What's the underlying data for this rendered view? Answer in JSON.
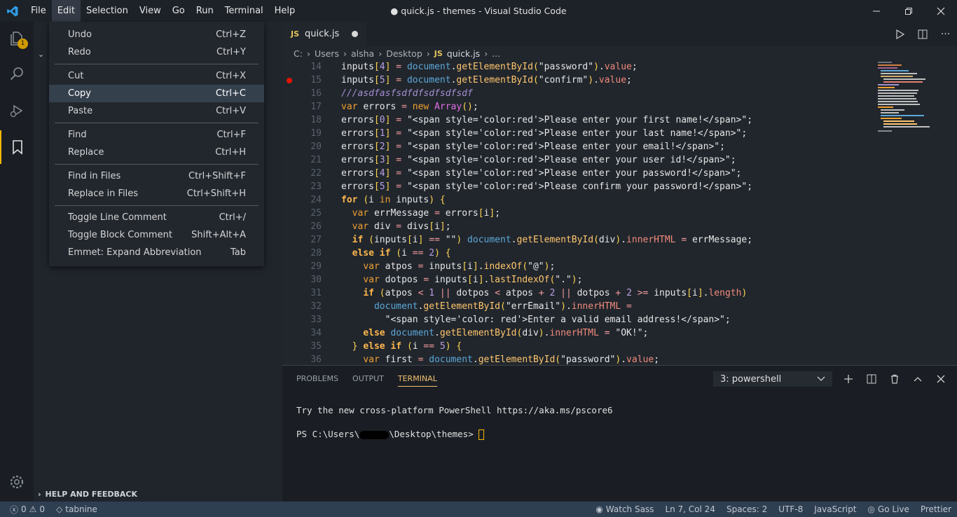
{
  "window": {
    "title": "● quick.js - themes - Visual Studio Code"
  },
  "menubar": [
    "File",
    "Edit",
    "Selection",
    "View",
    "Go",
    "Run",
    "Terminal",
    "Help"
  ],
  "activity": {
    "badge": "1"
  },
  "edit_menu": {
    "groups": [
      [
        {
          "label": "Undo",
          "shortcut": "Ctrl+Z"
        },
        {
          "label": "Redo",
          "shortcut": "Ctrl+Y"
        }
      ],
      [
        {
          "label": "Cut",
          "shortcut": "Ctrl+X"
        },
        {
          "label": "Copy",
          "shortcut": "Ctrl+C"
        },
        {
          "label": "Paste",
          "shortcut": "Ctrl+V"
        }
      ],
      [
        {
          "label": "Find",
          "shortcut": "Ctrl+F"
        },
        {
          "label": "Replace",
          "shortcut": "Ctrl+H"
        }
      ],
      [
        {
          "label": "Find in Files",
          "shortcut": "Ctrl+Shift+F"
        },
        {
          "label": "Replace in Files",
          "shortcut": "Ctrl+Shift+H"
        }
      ],
      [
        {
          "label": "Toggle Line Comment",
          "shortcut": "Ctrl+/"
        },
        {
          "label": "Toggle Block Comment",
          "shortcut": "Shift+Alt+A"
        },
        {
          "label": "Emmet: Expand Abbreviation",
          "shortcut": "Tab"
        }
      ]
    ],
    "highlighted": "Copy"
  },
  "sidebar": {
    "help_feedback": "HELP AND FEEDBACK"
  },
  "tab": {
    "icon": "JS",
    "name": "quick.js"
  },
  "breadcrumb": {
    "parts": [
      "C:",
      "Users",
      "alsha",
      "Desktop"
    ],
    "file_icon": "JS",
    "file": "quick.js",
    "more": "..."
  },
  "editor": {
    "breakpoint_line": "15",
    "lines": [
      {
        "n": "14",
        "html": "<span class='id'>inputs</span><span class='br'>[</span><span class='num'>4</span><span class='br'>]</span> <span class='op'>=</span> <span class='dom'>document</span>.<span class='mt'>getElementById</span><span class='br'>(</span><span class='st'>\"password\"</span><span class='br'>)</span>.<span class='prop'>value</span>;"
      },
      {
        "n": "15",
        "html": "<span class='id'>inputs</span><span class='br'>[</span><span class='num'>5</span><span class='br'>]</span> <span class='op'>=</span> <span class='dom'>document</span>.<span class='mt'>getElementById</span><span class='br'>(</span><span class='st'>\"confirm\"</span><span class='br'>)</span>.<span class='prop'>value</span>;"
      },
      {
        "n": "16",
        "html": "<span class='cm'>///asdfasfsdfdfsdfsdfsdf</span>"
      },
      {
        "n": "17",
        "html": "<span class='kw'>var</span> <span class='id'>errors</span> <span class='op'>=</span> <span class='kw'>new</span> <span class='cls'>Array</span><span class='br'>()</span>;"
      },
      {
        "n": "18",
        "html": "<span class='id'>errors</span><span class='br'>[</span><span class='num'>0</span><span class='br'>]</span> <span class='op'>=</span> <span class='st'>\"&lt;span style='color:red'&gt;Please enter your first name!&lt;/span&gt;\"</span>;"
      },
      {
        "n": "19",
        "html": "<span class='id'>errors</span><span class='br'>[</span><span class='num'>1</span><span class='br'>]</span> <span class='op'>=</span> <span class='st'>\"&lt;span style='color:red'&gt;Please enter your last name!&lt;/span&gt;\"</span>;"
      },
      {
        "n": "20",
        "html": "<span class='id'>errors</span><span class='br'>[</span><span class='num'>2</span><span class='br'>]</span> <span class='op'>=</span> <span class='st'>\"&lt;span style='color:red'&gt;Please enter your email!&lt;/span&gt;\"</span>;"
      },
      {
        "n": "21",
        "html": "<span class='id'>errors</span><span class='br'>[</span><span class='num'>3</span><span class='br'>]</span> <span class='op'>=</span> <span class='st'>\"&lt;span style='color:red'&gt;Please enter your user id!&lt;/span&gt;\"</span>;"
      },
      {
        "n": "22",
        "html": "<span class='id'>errors</span><span class='br'>[</span><span class='num'>4</span><span class='br'>]</span> <span class='op'>=</span> <span class='st'>\"&lt;span style='color:red'&gt;Please enter your password!&lt;/span&gt;\"</span>;"
      },
      {
        "n": "23",
        "html": "<span class='id'>errors</span><span class='br'>[</span><span class='num'>5</span><span class='br'>]</span> <span class='op'>=</span> <span class='st'>\"&lt;span style='color:red'&gt;Please confirm your password!&lt;/span&gt;\"</span>;"
      },
      {
        "n": "24",
        "html": "<span class='kb'>for</span> <span class='br'>(</span><span class='id'>i</span> <span class='kw'>in</span> <span class='id'>inputs</span><span class='br'>)</span> <span class='br'>{</span>"
      },
      {
        "n": "25",
        "html": "  <span class='kw'>var</span> <span class='id'>errMessage</span> <span class='op'>=</span> <span class='id'>errors</span><span class='br'>[</span><span class='id'>i</span><span class='br'>]</span>;"
      },
      {
        "n": "26",
        "html": "  <span class='kw'>var</span> <span class='id'>div</span> <span class='op'>=</span> <span class='id'>divs</span><span class='br'>[</span><span class='id'>i</span><span class='br'>]</span>;"
      },
      {
        "n": "27",
        "html": "  <span class='kb'>if</span> <span class='br'>(</span><span class='id'>inputs</span><span class='br'>[</span><span class='id'>i</span><span class='br'>]</span> <span class='op'>==</span> <span class='st'>\"\"</span><span class='br'>)</span> <span class='dom'>document</span>.<span class='mt'>getElementById</span><span class='br'>(</span><span class='id'>div</span><span class='br'>)</span>.<span class='prop'>innerHTML</span> <span class='op'>=</span> <span class='id'>errMessage</span>;"
      },
      {
        "n": "28",
        "html": "  <span class='kb'>else if</span> <span class='br'>(</span><span class='id'>i</span> <span class='op'>==</span> <span class='num'>2</span><span class='br'>)</span> <span class='br'>{</span>"
      },
      {
        "n": "29",
        "html": "    <span class='kw'>var</span> <span class='id'>atpos</span> <span class='op'>=</span> <span class='id'>inputs</span><span class='br'>[</span><span class='id'>i</span><span class='br'>]</span>.<span class='mt'>indexOf</span><span class='br'>(</span><span class='st'>\"@\"</span><span class='br'>)</span>;"
      },
      {
        "n": "30",
        "html": "    <span class='kw'>var</span> <span class='id'>dotpos</span> <span class='op'>=</span> <span class='id'>inputs</span><span class='br'>[</span><span class='id'>i</span><span class='br'>]</span>.<span class='mt'>lastIndexOf</span><span class='br'>(</span><span class='st'>\".\"</span><span class='br'>)</span>;"
      },
      {
        "n": "31",
        "html": "    <span class='kb'>if</span> <span class='br'>(</span><span class='id'>atpos</span> <span class='op'>&lt;</span> <span class='num'>1</span> <span class='op'>||</span> <span class='id'>dotpos</span> <span class='op'>&lt;</span> <span class='id'>atpos</span> <span class='op'>+</span> <span class='num'>2</span> <span class='op'>||</span> <span class='id'>dotpos</span> <span class='op'>+</span> <span class='num'>2</span> <span class='op'>&gt;=</span> <span class='id'>inputs</span><span class='br'>[</span><span class='id'>i</span><span class='br'>]</span>.<span class='prop'>length</span><span class='br'>)</span>"
      },
      {
        "n": "32",
        "html": "      <span class='dom'>document</span>.<span class='mt'>getElementById</span><span class='br'>(</span><span class='st'>\"errEmail\"</span><span class='br'>)</span>.<span class='prop'>innerHTML</span> <span class='op'>=</span>"
      },
      {
        "n": "33",
        "html": "        <span class='st'>\"&lt;span style='color: red'&gt;Enter a valid email address!&lt;/span&gt;\"</span>;"
      },
      {
        "n": "34",
        "html": "    <span class='kb'>else</span> <span class='dom'>document</span>.<span class='mt'>getElementById</span><span class='br'>(</span><span class='id'>div</span><span class='br'>)</span>.<span class='prop'>innerHTML</span> <span class='op'>=</span> <span class='st'>\"OK!\"</span>;"
      },
      {
        "n": "35",
        "html": "  <span class='br'>}</span> <span class='kb'>else if</span> <span class='br'>(</span><span class='id'>i</span> <span class='op'>==</span> <span class='num'>5</span><span class='br'>)</span> <span class='br'>{</span>"
      },
      {
        "n": "36",
        "html": "    <span class='kw'>var</span> <span class='id'>first</span> <span class='op'>=</span> <span class='dom'>document</span>.<span class='mt'>getElementById</span><span class='br'>(</span><span class='st'>\"password\"</span><span class='br'>)</span>.<span class='prop'>value</span>;"
      }
    ]
  },
  "panel": {
    "tabs": [
      "PROBLEMS",
      "OUTPUT",
      "TERMINAL"
    ],
    "active_tab": "TERMINAL",
    "terminal_select": "3: powershell",
    "line1": "Try the new cross-platform PowerShell https://aka.ms/pscore6",
    "prompt_prefix": "PS C:\\Users\\",
    "prompt_suffix": "\\Desktop\\themes> "
  },
  "statusbar": {
    "errors": "0",
    "warnings": "0",
    "tabnine": "tabnine",
    "right": [
      "Watch Sass",
      "Ln 7, Col 24",
      "Spaces: 2",
      "UTF-8",
      "JavaScript",
      "Go Live",
      "Prettier"
    ]
  },
  "colors": {
    "accent": "#f5b800",
    "statusbar": "#2f3f52"
  }
}
